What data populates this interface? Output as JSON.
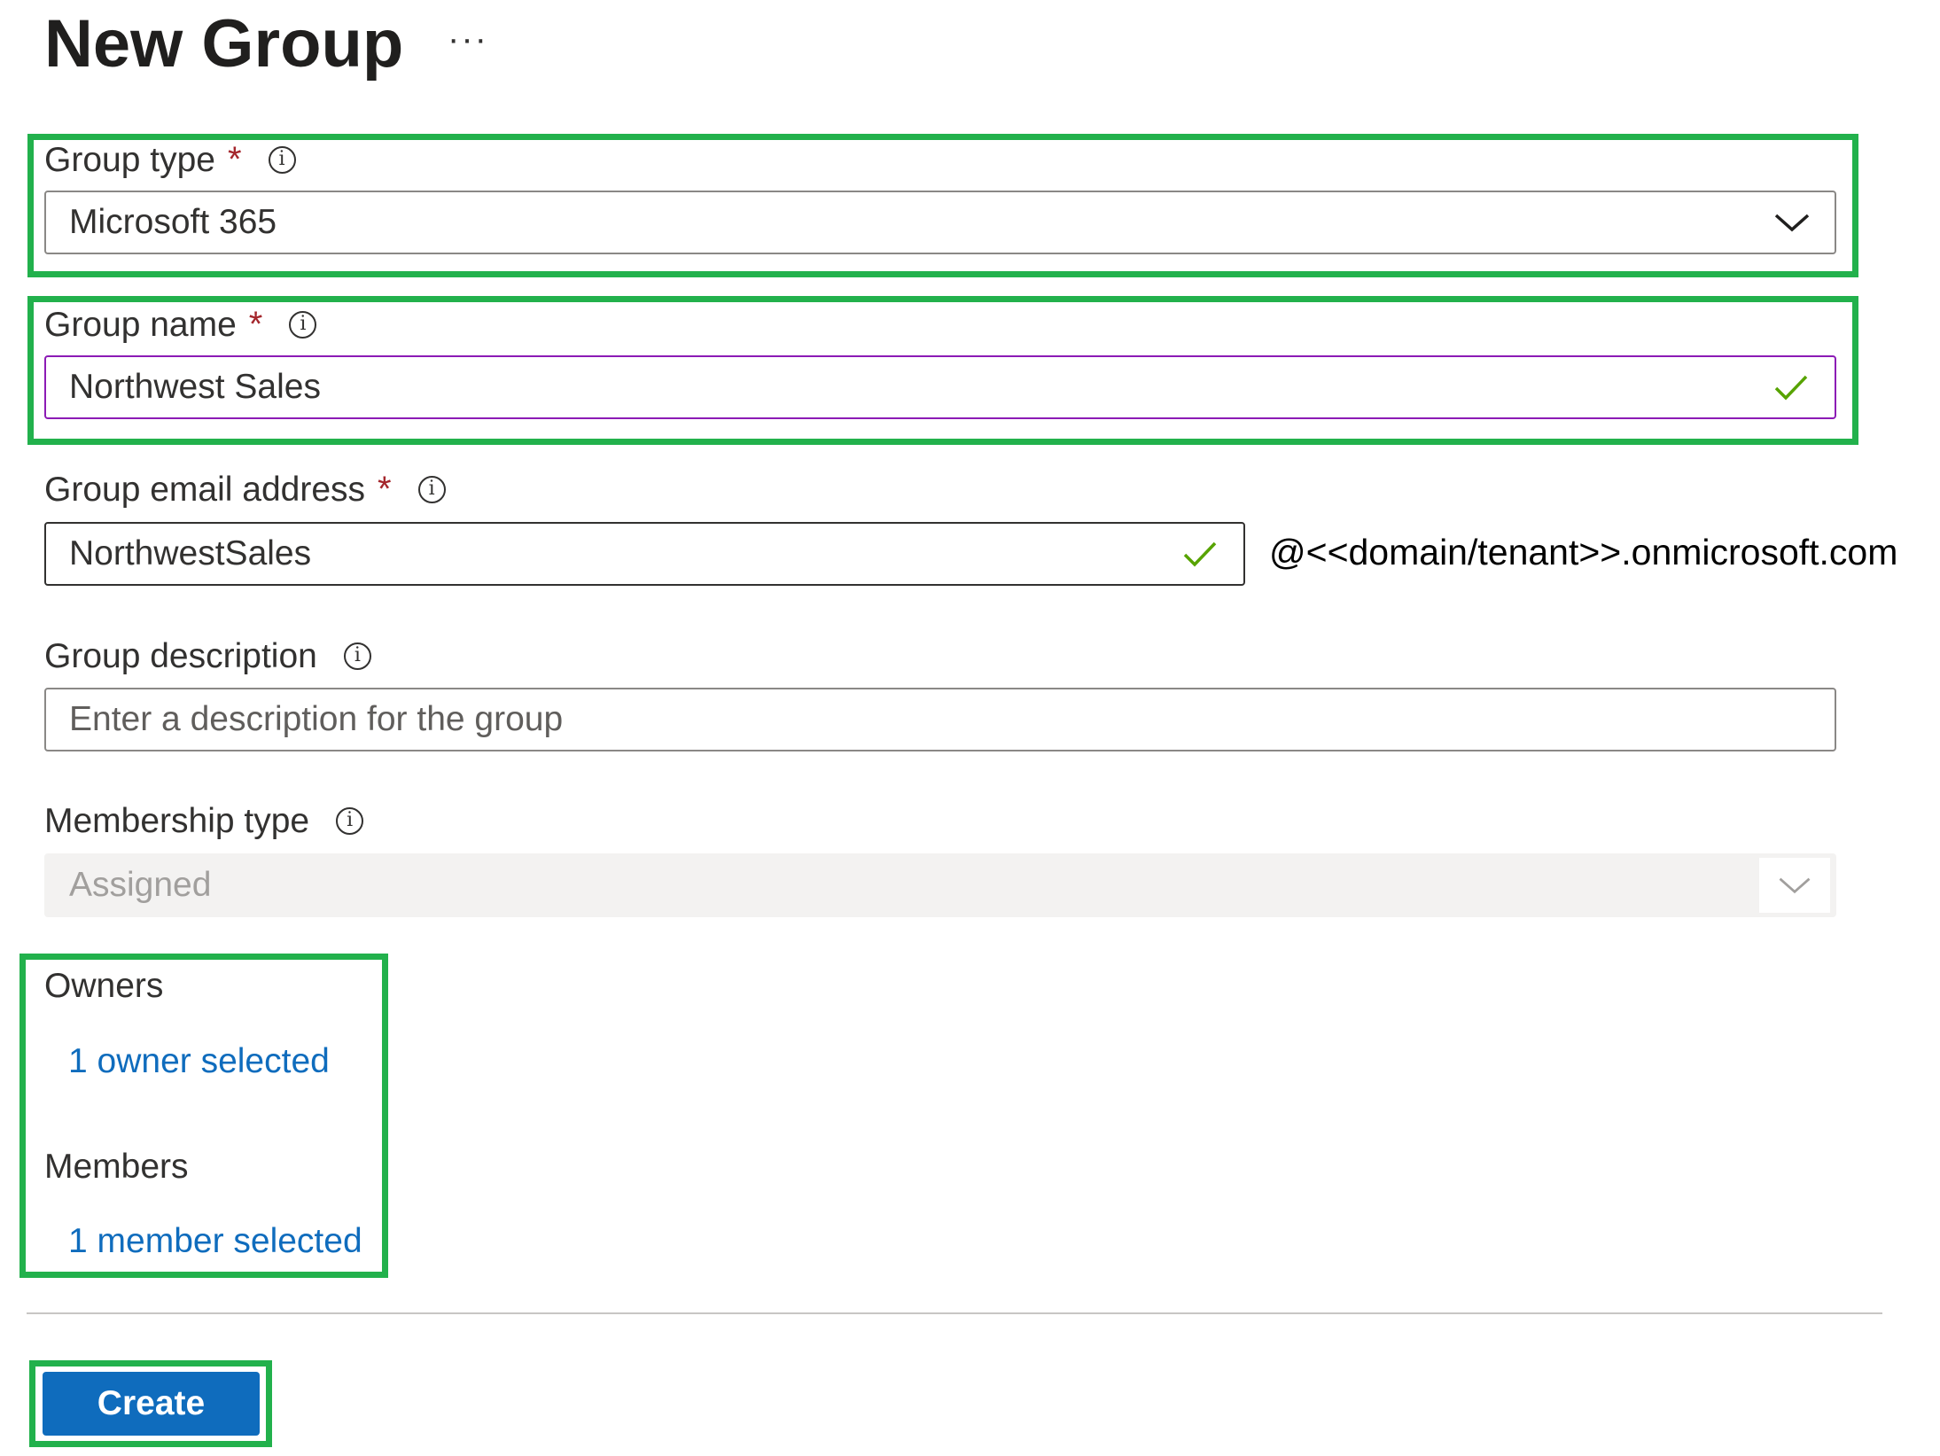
{
  "page": {
    "title": "New Group",
    "more_actions": "···"
  },
  "group_type": {
    "label": "Group type",
    "required": "*",
    "value": "Microsoft 365"
  },
  "group_name": {
    "label": "Group name",
    "required": "*",
    "value": "Northwest Sales"
  },
  "group_email": {
    "label": "Group email address",
    "required": "*",
    "value": "NorthwestSales",
    "suffix": "@<<domain/tenant>>.onmicrosoft.com"
  },
  "group_description": {
    "label": "Group description",
    "placeholder": "Enter a description for the group",
    "value": ""
  },
  "membership_type": {
    "label": "Membership type",
    "value": "Assigned"
  },
  "owners": {
    "label": "Owners",
    "link": "1 owner selected"
  },
  "members": {
    "label": "Members",
    "link": "1 member selected"
  },
  "actions": {
    "create": "Create"
  },
  "colors": {
    "highlight": "#22b14c",
    "accent": "#0f6cbd",
    "required": "#a4262c",
    "valid_check": "#57a300",
    "focus_border": "#8c1bb5"
  }
}
